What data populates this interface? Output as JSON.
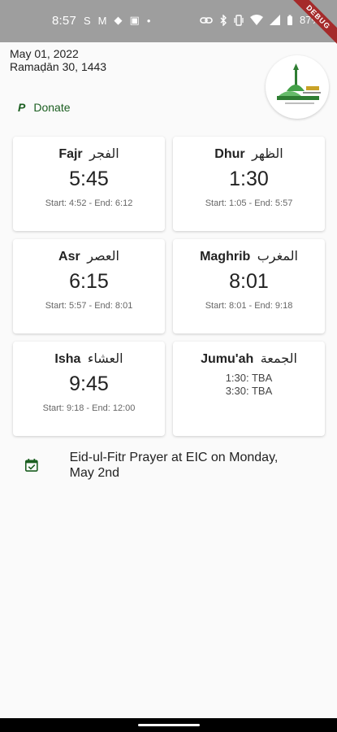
{
  "status_bar": {
    "time": "8:57",
    "battery": "87%",
    "left_icons": [
      "S",
      "M",
      "◆",
      "▣",
      "•"
    ]
  },
  "debug_label": "DEBUG",
  "header": {
    "gregorian_date": "May 01, 2022",
    "hijri_date": "Ramaḍān 30, 1443",
    "donate_label": "Donate",
    "donate_icon_glyph": "P"
  },
  "prayers": [
    {
      "name": "Fajr",
      "arabic": "الفجر",
      "time": "5:45",
      "range": "Start: 4:52 - End: 6:12"
    },
    {
      "name": "Dhur",
      "arabic": "الظهر",
      "time": "1:30",
      "range": "Start: 1:05 - End: 5:57"
    },
    {
      "name": "Asr",
      "arabic": "العصر",
      "time": "6:15",
      "range": "Start: 5:57 - End: 8:01"
    },
    {
      "name": "Maghrib",
      "arabic": "المغرب",
      "time": "8:01",
      "range": "Start: 8:01 - End: 9:18"
    },
    {
      "name": "Isha",
      "arabic": "العشاء",
      "time": "9:45",
      "range": "Start: 9:18 - End: 12:00"
    }
  ],
  "jumuah": {
    "name": "Jumu'ah",
    "arabic": "الجمعة",
    "slots": [
      "1:30: TBA",
      "3:30: TBA"
    ]
  },
  "event": {
    "text": "Eid-ul-Fitr Prayer at EIC on Monday, May 2nd"
  },
  "colors": {
    "accent": "#1b5e20",
    "status_bar": "#9e9e9e",
    "debug_ribbon": "#a52a2a"
  }
}
